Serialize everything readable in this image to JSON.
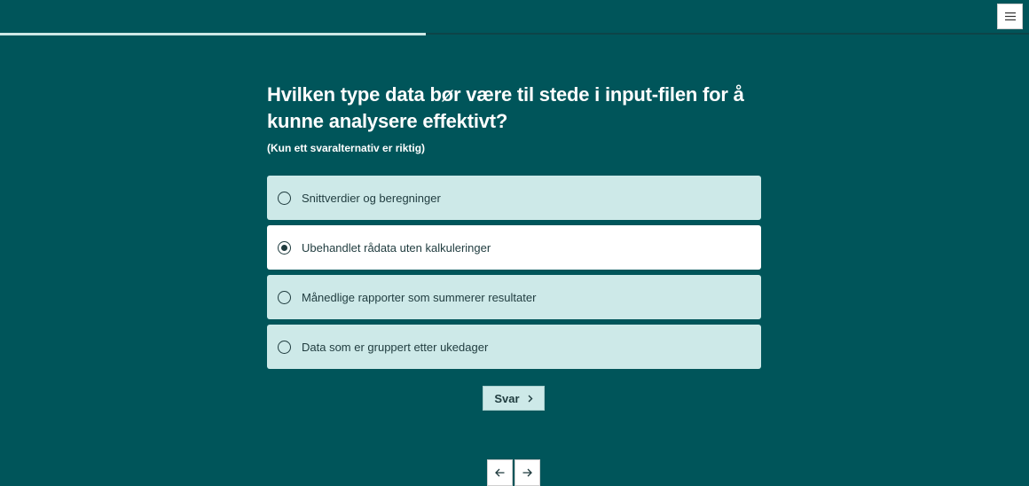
{
  "progress": {
    "fraction": 0.414
  },
  "menu": {
    "icon": "hamburger-menu-icon"
  },
  "question": {
    "title": "Hvilken type data bør være til stede i input-filen for å kunne analysere effektivt?",
    "hint": "(Kun ett svaralternativ er riktig)"
  },
  "options": [
    {
      "label": "Snittverdier og beregninger",
      "selected": false
    },
    {
      "label": "Ubehandlet rådata uten kalkuleringer",
      "selected": true
    },
    {
      "label": "Månedlige rapporter som summerer resultater",
      "selected": false
    },
    {
      "label": "Data som er gruppert etter ukedager",
      "selected": false
    }
  ],
  "submit": {
    "label": "Svar",
    "icon": "chevron-right-icon"
  },
  "navigation": {
    "prev_icon": "arrow-left-icon",
    "next_icon": "arrow-right-icon"
  },
  "colors": {
    "background": "#00555a",
    "option_bg": "#cde9e8",
    "option_selected_bg": "#ffffff",
    "progress_fill": "#cfe8e6",
    "text_dark": "#1f3b3e"
  }
}
